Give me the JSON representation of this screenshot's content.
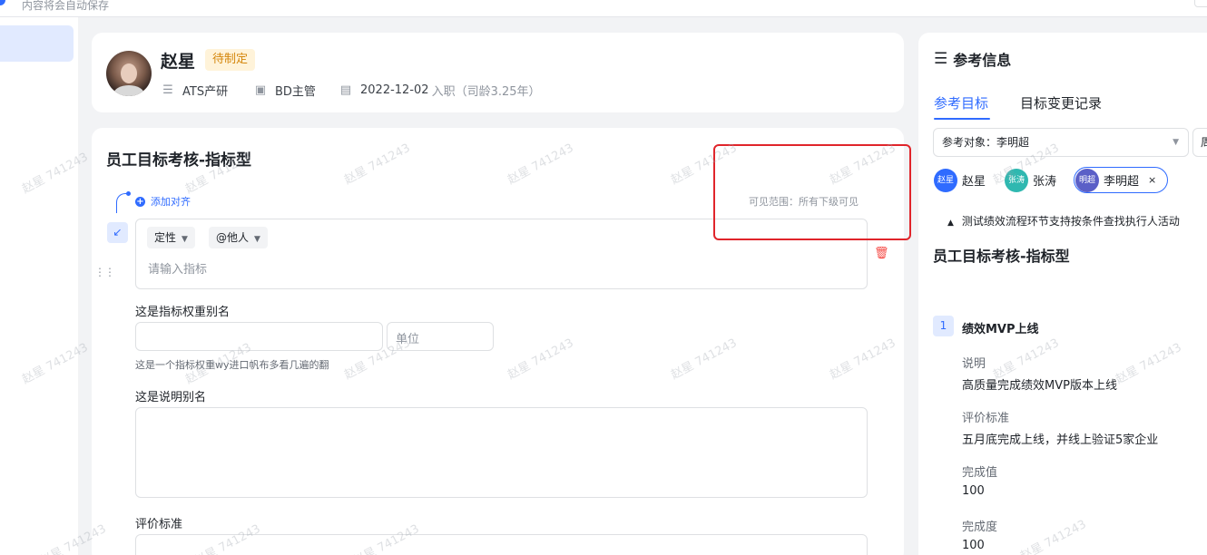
{
  "topbar": {
    "autosave_text": "内容将会自动保存"
  },
  "profile": {
    "name": "赵星",
    "status": "待制定",
    "department": "ATS产研",
    "position": "BD主管",
    "join_date": "2022-12-02",
    "join_suffix": "入职（司龄3.25年）"
  },
  "form": {
    "title": "员工目标考核-指标型",
    "add_align": "添加对齐",
    "visible_range": "可见范围：所有下级可见",
    "chip_type": "定性",
    "chip_mention": "@他人",
    "indicator_placeholder": "请输入指标",
    "weight_label": "这是指标权重别名",
    "unit_placeholder": "单位",
    "weight_hint": "这是一个指标权重wy进口帆布多看几遍的翻",
    "desc_label": "这是说明别名",
    "criteria_label": "评价标准"
  },
  "reference": {
    "title": "参考信息",
    "tabs": [
      "参考目标",
      "目标变更记录"
    ],
    "active_tab": "参考目标",
    "ref_target_select": "参考对象：李明超",
    "second_select": "周",
    "people": [
      {
        "avatar_text": "赵星",
        "name": "赵星",
        "color": "#2f6bff"
      },
      {
        "avatar_text": "张涛",
        "name": "张涛",
        "color": "#2fb8b0"
      },
      {
        "avatar_text": "明超",
        "name": "李明超",
        "color": "#5b5fc7",
        "close": "×"
      }
    ],
    "cycle_text": "测试绩效流程环节支持按条件查找执行人活动",
    "subtitle": "员工目标考核-指标型",
    "goal": {
      "number": "1",
      "name": "绩效MVP上线",
      "desc_label": "说明",
      "desc_value": "高质量完成绩效MVP版本上线",
      "criteria_label": "评价标准",
      "criteria_value": "五月底完成上线，并线上验证5家企业",
      "completion_value_label": "完成值",
      "completion_value": "100",
      "completion_rate_label": "完成度",
      "completion_rate": "100"
    }
  },
  "watermark": "赵星 741243",
  "colors": {
    "accent": "#2f6bff",
    "warning": "#d4860b",
    "danger": "#f54a45",
    "highlight": "#e0252b"
  }
}
